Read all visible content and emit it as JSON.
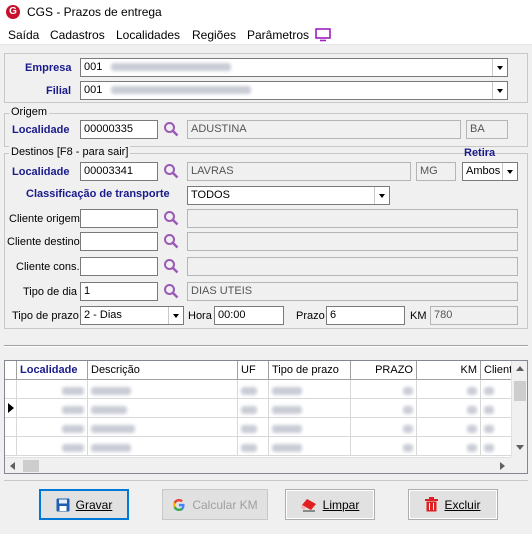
{
  "window": {
    "title": "CGS - Prazos de entrega",
    "icon_letter": "G"
  },
  "menu": [
    "Saída",
    "Cadastros",
    "Localidades",
    "Regiões",
    "Parâmetros"
  ],
  "empresa": {
    "label": "Empresa",
    "code": "001"
  },
  "filial": {
    "label": "Filial",
    "code": "001"
  },
  "origem": {
    "title": "Origem",
    "localidade_label": "Localidade",
    "localidade_code": "00000335",
    "localidade_name": "ADUSTINA",
    "uf": "BA"
  },
  "destinos": {
    "title": "Destinos  [F8 - para sair]",
    "localidade_label": "Localidade",
    "localidade_code": "00003341",
    "localidade_name": "LAVRAS",
    "uf": "MG",
    "retira_label": "Retira",
    "retira_value": "Ambos",
    "classificacao_label": "Classificação de transporte",
    "classificacao_value": "TODOS",
    "cliente_origem_label": "Cliente origem",
    "cliente_destino_label": "Cliente destino",
    "cliente_cons_label": "Cliente cons.",
    "tipo_dia_label": "Tipo de dia",
    "tipo_dia_code": "1",
    "tipo_dia_name": "DIAS UTEIS",
    "tipo_prazo_label": "Tipo de prazo",
    "tipo_prazo_value": "2 - Dias",
    "hora_label": "Hora",
    "hora_value": "00:00",
    "prazo_label": "Prazo",
    "prazo_value": "6",
    "km_label": "KM",
    "km_value": "780"
  },
  "grid": {
    "columns": [
      "Localidade",
      "Descrição",
      "UF",
      "Tipo de prazo",
      "PRAZO",
      "KM",
      "Client"
    ]
  },
  "buttons": {
    "gravar": "Gravar",
    "calcular_km": "Calcular KM",
    "limpar": "Limpar",
    "excluir": "Excluir"
  },
  "colors": {
    "accent_label": "#1a1a8c",
    "search_icon": "#9b59b6",
    "focus_border": "#0078d7"
  }
}
